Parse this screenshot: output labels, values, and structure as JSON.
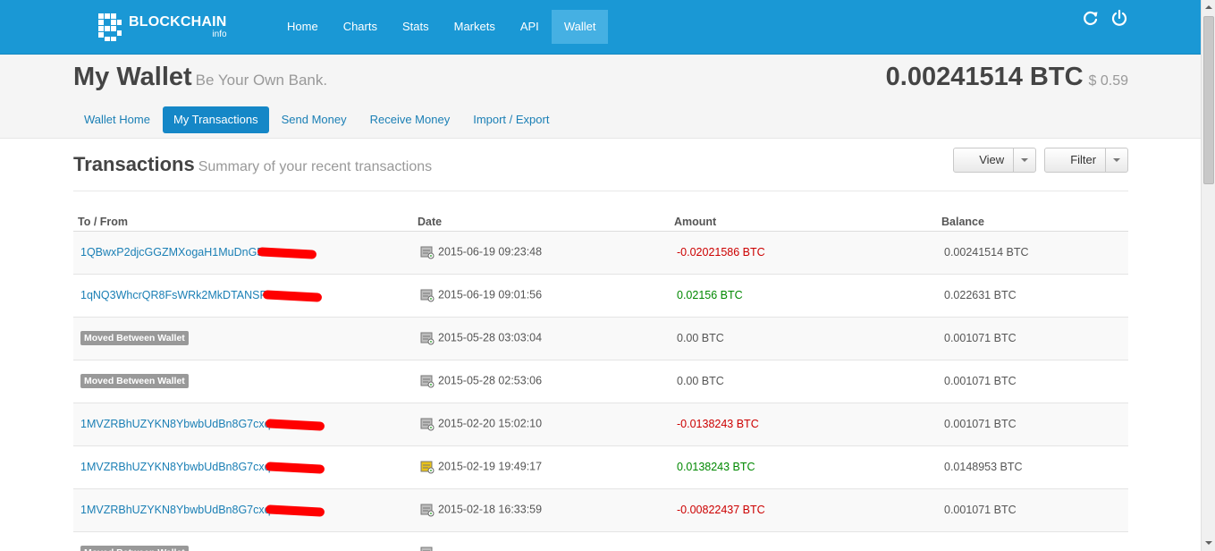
{
  "navbar": {
    "brand": "BLOCKCHAIN",
    "brand_sub": "info",
    "items": [
      {
        "label": "Home",
        "active": false
      },
      {
        "label": "Charts",
        "active": false
      },
      {
        "label": "Stats",
        "active": false
      },
      {
        "label": "Markets",
        "active": false
      },
      {
        "label": "API",
        "active": false
      },
      {
        "label": "Wallet",
        "active": true
      }
    ],
    "icons": [
      "refresh-icon",
      "power-icon"
    ]
  },
  "wallet": {
    "title": "My Wallet",
    "tagline": "Be Your Own Bank.",
    "balance_btc": "0.00241514 BTC",
    "balance_usd": "$ 0.59",
    "subnav": [
      {
        "label": "Wallet Home",
        "active": false
      },
      {
        "label": "My Transactions",
        "active": true
      },
      {
        "label": "Send Money",
        "active": false
      },
      {
        "label": "Receive Money",
        "active": false
      },
      {
        "label": "Import / Export",
        "active": false
      }
    ]
  },
  "transactions": {
    "title": "Transactions",
    "subtitle": "Summary of your recent transactions",
    "view_label": "View",
    "filter_label": "Filter",
    "columns": [
      "To / From",
      "Date",
      "Amount",
      "Balance"
    ],
    "rows": [
      {
        "to_from": "1QBwxP2djcGGZMXogaH1MuDnG5",
        "redacted": true,
        "moved": false,
        "date": "2015-06-19 09:23:48",
        "amount": "-0.02021586 BTC",
        "sign": "neg",
        "balance": "0.00241514 BTC",
        "icon": "gray"
      },
      {
        "to_from": "1qNQ3WhcrQR8FsWRk2MkDTANSR",
        "redacted": true,
        "moved": false,
        "date": "2015-06-19 09:01:56",
        "amount": "0.02156 BTC",
        "sign": "pos",
        "balance": "0.022631 BTC",
        "icon": "gray"
      },
      {
        "to_from": "Moved Between Wallet",
        "redacted": false,
        "moved": true,
        "date": "2015-05-28 03:03:04",
        "amount": "0.00 BTC",
        "sign": "zero",
        "balance": "0.001071 BTC",
        "icon": "gray"
      },
      {
        "to_from": "Moved Between Wallet",
        "redacted": false,
        "moved": true,
        "date": "2015-05-28 02:53:06",
        "amount": "0.00 BTC",
        "sign": "zero",
        "balance": "0.001071 BTC",
        "icon": "gray"
      },
      {
        "to_from": "1MVZRBhUZYKN8YbwbUdBn8G7cxq",
        "redacted": true,
        "moved": false,
        "date": "2015-02-20 15:02:10",
        "amount": "-0.0138243 BTC",
        "sign": "neg",
        "balance": "0.001071 BTC",
        "icon": "gray"
      },
      {
        "to_from": "1MVZRBhUZYKN8YbwbUdBn8G7cxq",
        "redacted": true,
        "moved": false,
        "date": "2015-02-19 19:49:17",
        "amount": "0.0138243 BTC",
        "sign": "pos",
        "balance": "0.0148953 BTC",
        "icon": "yellow"
      },
      {
        "to_from": "1MVZRBhUZYKN8YbwbUdBn8G7cxq",
        "redacted": true,
        "moved": false,
        "date": "2015-02-18 16:33:59",
        "amount": "-0.00822437 BTC",
        "sign": "neg",
        "balance": "0.001071 BTC",
        "icon": "gray"
      },
      {
        "to_from": "Moved Between Wallet",
        "redacted": false,
        "moved": true,
        "date": "",
        "amount": "",
        "sign": "neg",
        "balance": "",
        "icon": "gray"
      }
    ]
  },
  "colors": {
    "navbar": "#1a98d5",
    "nav_active": "#45b0e3",
    "link": "#1a7fb5",
    "negative": "#cc0000",
    "positive": "#008800",
    "redaction": "#ff0000"
  }
}
